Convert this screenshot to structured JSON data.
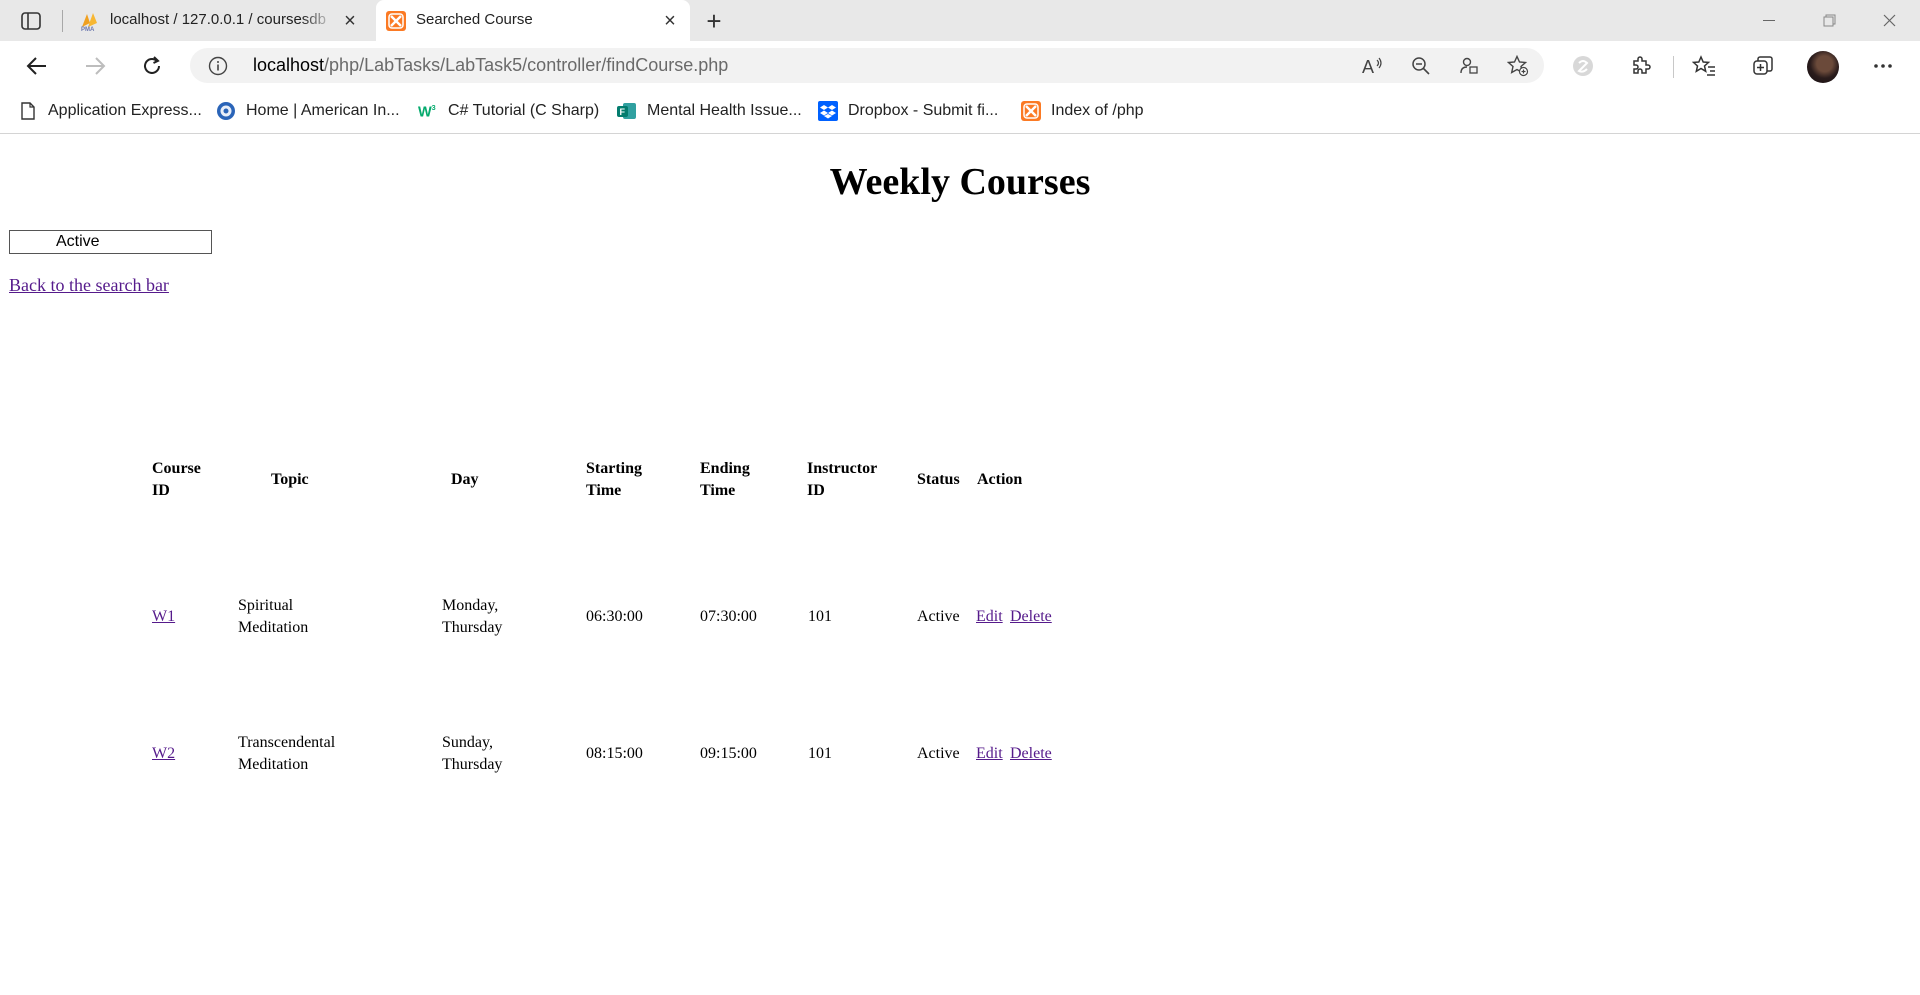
{
  "browser": {
    "tabs": [
      {
        "title": "localhost / 127.0.0.1 / coursesdb",
        "active": false,
        "favicon": "phpmyadmin-icon"
      },
      {
        "title": "Searched Course",
        "active": true,
        "favicon": "xampp-icon"
      }
    ],
    "address": {
      "host": "localhost",
      "path": "/php/LabTasks/LabTask5/controller/findCourse.php"
    },
    "bookmarks": [
      {
        "label": "Application Express...",
        "icon": "page-icon"
      },
      {
        "label": "Home | American In...",
        "icon": "globe-icon"
      },
      {
        "label": "C# Tutorial (C Sharp)",
        "icon": "w3schools-icon"
      },
      {
        "label": "Mental Health Issue...",
        "icon": "forms-icon"
      },
      {
        "label": "Dropbox - Submit fi...",
        "icon": "dropbox-icon"
      },
      {
        "label": "Index of /php",
        "icon": "xampp-icon"
      }
    ]
  },
  "page": {
    "title": "Weekly Courses",
    "status_value": "Active",
    "back_link": "Back to the search bar",
    "table": {
      "headers": {
        "course_id": [
          "Course",
          "ID"
        ],
        "topic": "Topic",
        "day": "Day",
        "starting_time": [
          "Starting",
          "Time"
        ],
        "ending_time": [
          "Ending",
          "Time"
        ],
        "instructor_id": [
          "Instructor",
          "ID"
        ],
        "status": "Status",
        "action": "Action"
      },
      "rows": [
        {
          "id": "W1",
          "topic": [
            "Spiritual",
            "Meditation"
          ],
          "day": [
            "Monday,",
            "Thursday"
          ],
          "start": "06:30:00",
          "end": "07:30:00",
          "instructor": "101",
          "status": "Active",
          "edit": "Edit",
          "delete": "Delete"
        },
        {
          "id": "W2",
          "topic": [
            "Transcendental",
            "Meditation"
          ],
          "day": [
            "Sunday,",
            "Thursday"
          ],
          "start": "08:15:00",
          "end": "09:15:00",
          "instructor": "101",
          "status": "Active",
          "edit": "Edit",
          "delete": "Delete"
        }
      ]
    }
  },
  "colors": {
    "link_visited": "#551a8b",
    "tabstrip": "#e8e8e8",
    "omnibox": "#f2f2f2"
  }
}
